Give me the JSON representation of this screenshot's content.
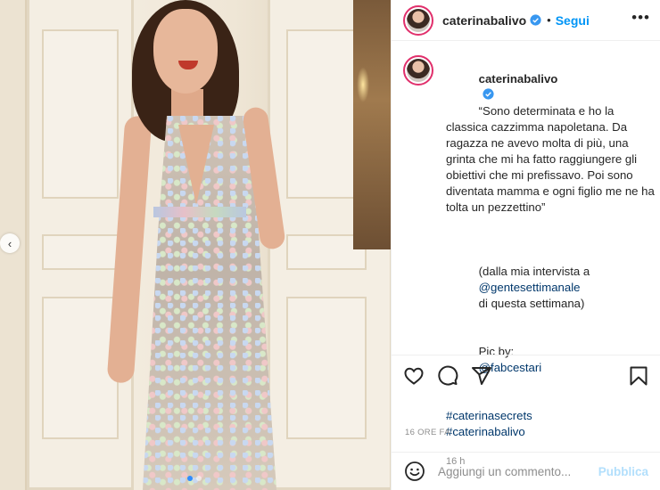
{
  "post": {
    "username": "caterinabalivo",
    "separator": "•",
    "follow_label": "Segui",
    "more_icon": "more-options-icon"
  },
  "caption": {
    "username": "caterinabalivo",
    "quote": "“Sono determinata e ho la classica cazzimma napoletana. Da ragazza ne avevo molta di più, una grinta che mi ha fatto raggiungere gli obiettivi che mi prefissavo. Poi sono diventata mamma e ogni figlio me ne ha tolta un pezzettino”",
    "source_prefix": "(dalla mia intervista a",
    "source_handle": "@gentesettimanale",
    "source_suffix": "di questa settimana)",
    "pic_prefix": "Pic by:",
    "pic_handle": "@fabcestari",
    "hashtag_1": "#caterinasecrets",
    "hashtag_2": "#caterinabalivo",
    "age": "16 h"
  },
  "footer": {
    "time_ago": "16 ORE FA",
    "comment_placeholder": "Aggiungi un commento...",
    "publish_label": "Pubblica"
  },
  "carousel": {
    "prev_icon": "chevron-left-icon",
    "slide_count": 2,
    "active_slide": 1
  },
  "colors": {
    "accent": "#0095f6",
    "publish_disabled": "#b2dffc",
    "story_ring": "#e1306c",
    "active_dot": "#2f8cff"
  }
}
